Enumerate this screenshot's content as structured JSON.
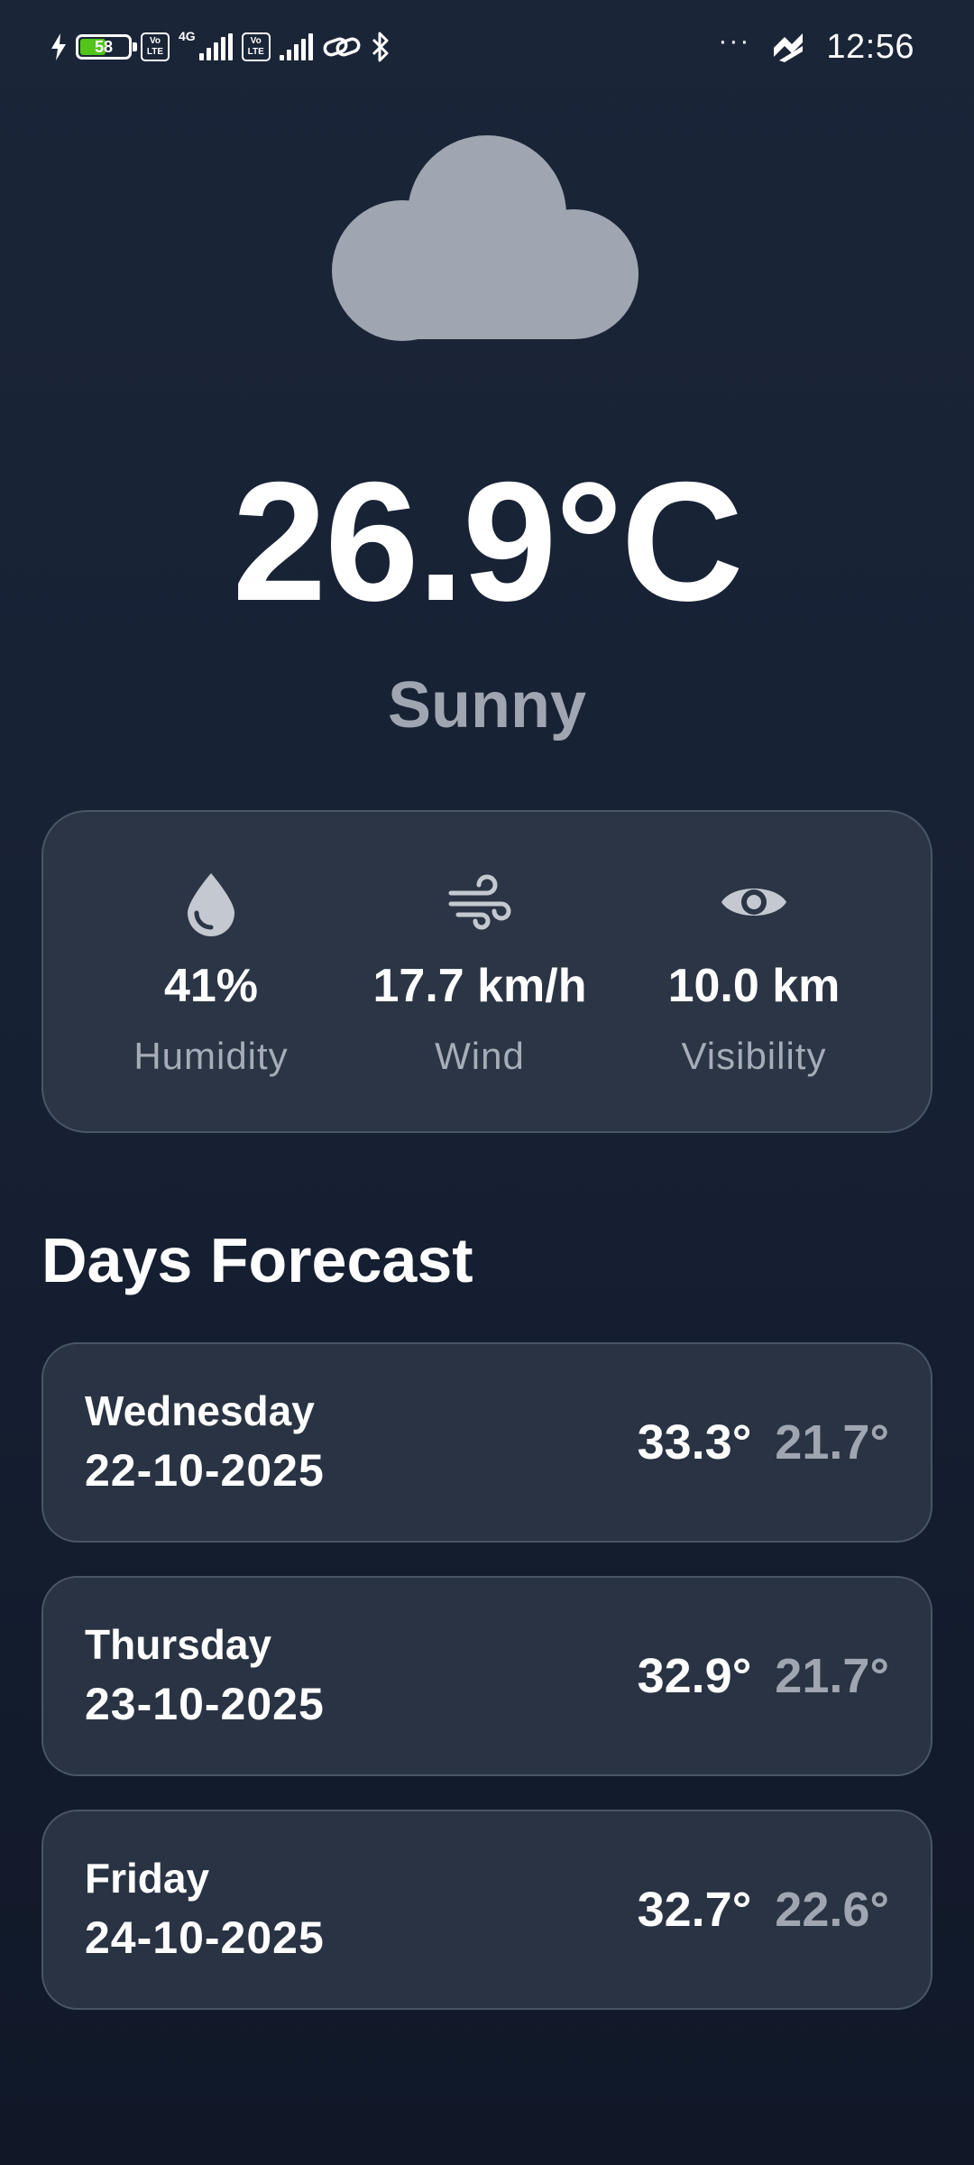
{
  "status_bar": {
    "battery_level": "58",
    "battery_fraction": 0.58,
    "network_type": "4G",
    "volte_label": "Vo LTE",
    "more_indicator": "···",
    "time": "12:56"
  },
  "current": {
    "icon": "cloud-icon",
    "temperature": "26.9°C",
    "condition": "Sunny"
  },
  "stats": [
    {
      "icon": "water-drop-icon",
      "value": "41%",
      "label": "Humidity"
    },
    {
      "icon": "wind-icon",
      "value": "17.7 km/h",
      "label": "Wind"
    },
    {
      "icon": "eye-icon",
      "value": "10.0 km",
      "label": "Visibility"
    }
  ],
  "forecast": {
    "title": "Days Forecast",
    "days": [
      {
        "day": "Wednesday",
        "date": "22-10-2025",
        "high": "33.3°",
        "low": "21.7°"
      },
      {
        "day": "Thursday",
        "date": "23-10-2025",
        "high": "32.9°",
        "low": "21.7°"
      },
      {
        "day": "Friday",
        "date": "24-10-2025",
        "high": "32.7°",
        "low": "22.6°"
      }
    ]
  },
  "colors": {
    "background": "#172134",
    "card": "#2b3545",
    "card_border": "#4a5568",
    "muted_text": "#a0a6b1",
    "battery": "#52c41a"
  }
}
